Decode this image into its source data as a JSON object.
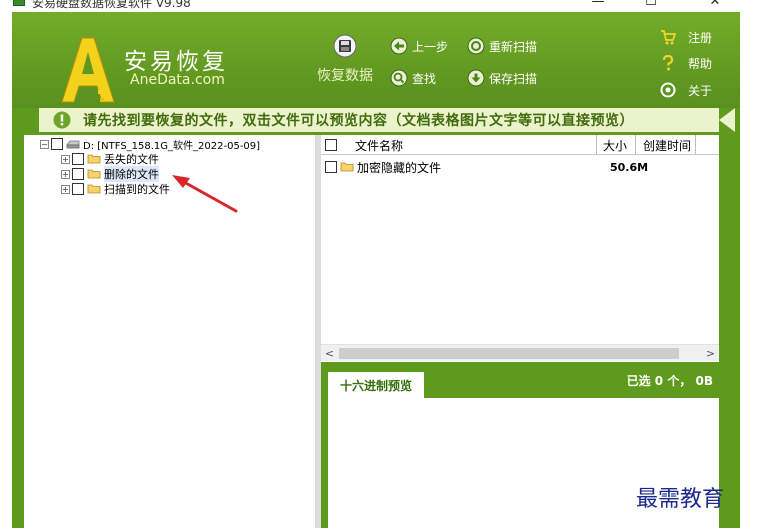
{
  "window": {
    "title": "安易硬盘数据恢复软件 V9.98",
    "minimize": "—",
    "maximize": "☐",
    "close": "✕"
  },
  "brand": {
    "name_cn": "安易恢复",
    "name_en": "AneData.com"
  },
  "toolbar": {
    "recover": "恢复数据",
    "prev": "上一步",
    "rescan": "重新扫描",
    "search": "查找",
    "save_scan": "保存扫描",
    "register": "注册",
    "help": "帮助",
    "about": "关于"
  },
  "notice": "请先找到要恢复的文件，双击文件可以预览内容（文档表格图片文字等可以直接预览）",
  "tree": {
    "root": "D:  [NTFS_158.1G_软件_2022-05-09]",
    "children": [
      "丢失的文件",
      "删除的文件",
      "扫描到的文件"
    ]
  },
  "list": {
    "columns": {
      "name": "文件名称",
      "size": "大小",
      "created": "创建时间"
    },
    "rows": [
      {
        "name": "加密隐藏的文件",
        "size": "50.6M",
        "created": ""
      }
    ]
  },
  "preview": {
    "tab": "十六进制预览",
    "selected": "已选 0 个， 0B"
  },
  "watermark": "最需教育",
  "colors": {
    "frame": "#5e9a1b",
    "notice_bg": "#eaf3cc",
    "notice_text": "#426b0c",
    "annotation": "#d9262c"
  }
}
